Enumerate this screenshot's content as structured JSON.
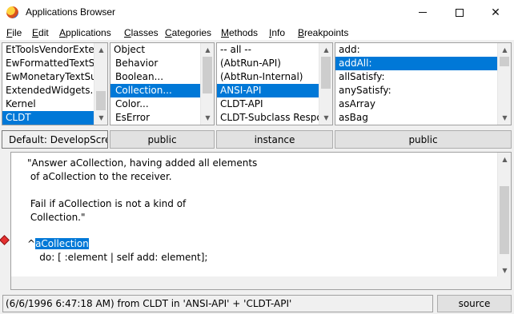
{
  "window": {
    "title": "Applications Browser",
    "minimize_icon": "minimize-icon",
    "maximize_icon": "maximize-icon",
    "close_icon": "close-icon"
  },
  "menu": [
    "File",
    "Edit",
    "Applications",
    "Classes",
    "Categories",
    "Methods",
    "Info",
    "Breakpoints"
  ],
  "applications": {
    "items": [
      "EtToolsVendorExter",
      "EwFormattedTextSu",
      "EwMonetaryTextSup",
      "ExtendedWidgets...",
      "Kernel",
      "CLDT"
    ],
    "selected": "CLDT"
  },
  "classes": {
    "items": [
      "Object",
      "Behavior",
      "Boolean...",
      "Collection...",
      "Color...",
      "EsError"
    ],
    "selected": "Collection..."
  },
  "categories": {
    "items": [
      "-- all --",
      "(AbtRun-API)",
      "(AbtRun-Internal)",
      "ANSI-API",
      "CLDT-API",
      "CLDT-Subclass Respo"
    ],
    "selected": "ANSI-API"
  },
  "methods": {
    "items": [
      "add:",
      "addAll:",
      "allSatisfy:",
      "anySatisfy:",
      "asArray",
      "asBag"
    ],
    "selected": "addAll:"
  },
  "toggles": {
    "config": "Default: DevelopScre",
    "classes_scope": "public",
    "side": "instance",
    "methods_scope": "public"
  },
  "source": {
    "comment_lines": [
      "\"Answer aCollection, having added all elements",
      " of aCollection to the receiver.",
      "",
      " Fail if aCollection is not a kind of",
      " Collection.\""
    ],
    "caret": "^",
    "highlighted": "aCollection",
    "last_line": "    do: [ :element | self add: element];"
  },
  "breakpoint_icon": "breakpoint-diamond-icon",
  "status": {
    "text": "(6/6/1996 6:47:18 AM) from CLDT in 'ANSI-API' + 'CLDT-API'",
    "source_button": "source"
  }
}
